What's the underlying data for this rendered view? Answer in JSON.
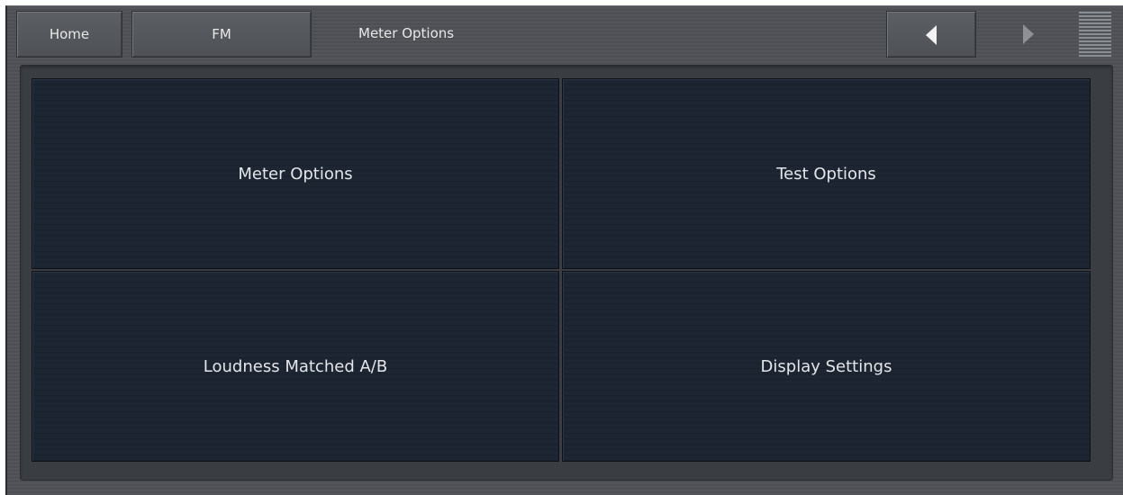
{
  "header": {
    "home_label": "Home",
    "fm_label": "FM",
    "breadcrumb": "Meter Options",
    "back_icon": "triangle-left-icon",
    "forward_icon": "triangle-right-icon",
    "menu_icon": "menu-icon"
  },
  "tiles": [
    {
      "label": "Meter Options"
    },
    {
      "label": "Test Options"
    },
    {
      "label": "Loudness Matched A/B"
    },
    {
      "label": "Display Settings"
    }
  ]
}
